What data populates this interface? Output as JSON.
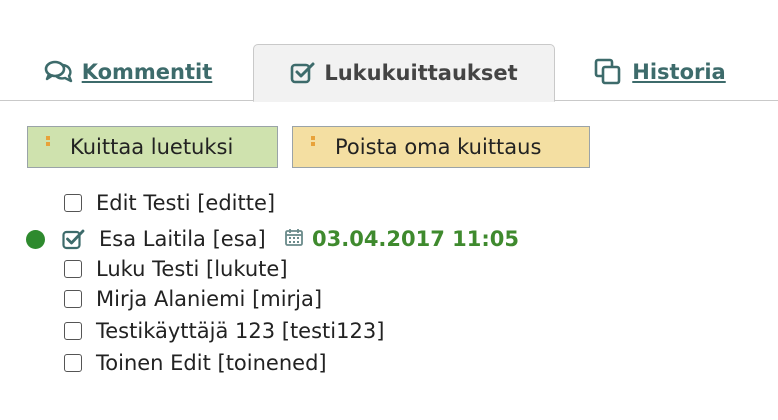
{
  "tabs": [
    {
      "label": "Kommentit",
      "icon": "comments-icon",
      "active": false
    },
    {
      "label": "Lukukuittaukset",
      "icon": "check-square-icon",
      "active": true
    },
    {
      "label": "Historia",
      "icon": "copy-icon",
      "active": false
    }
  ],
  "actions": {
    "mark_read_label": "Kuittaa luetuksi",
    "remove_receipt_label": "Poista oma kuittaus"
  },
  "readers": [
    {
      "name": "Edit Testi [editte]",
      "checked": false
    },
    {
      "name": "Esa Laitila [esa]",
      "checked": true,
      "current_user": true,
      "date": "03.04.2017 11:05"
    },
    {
      "name": "Luku Testi [lukute]",
      "checked": false
    },
    {
      "name": "Mirja Alaniemi [mirja]",
      "checked": false
    },
    {
      "name": "Testikäyttäjä 123 [testi123]",
      "checked": false
    },
    {
      "name": "Toinen Edit [toinened]",
      "checked": false
    }
  ],
  "colors": {
    "tab_text": "#3d6b6b",
    "button_green": "#cfe2ae",
    "button_yellow": "#f4dfa2",
    "status_dot": "#2e8a2e",
    "date_text": "#3f8a2e"
  }
}
